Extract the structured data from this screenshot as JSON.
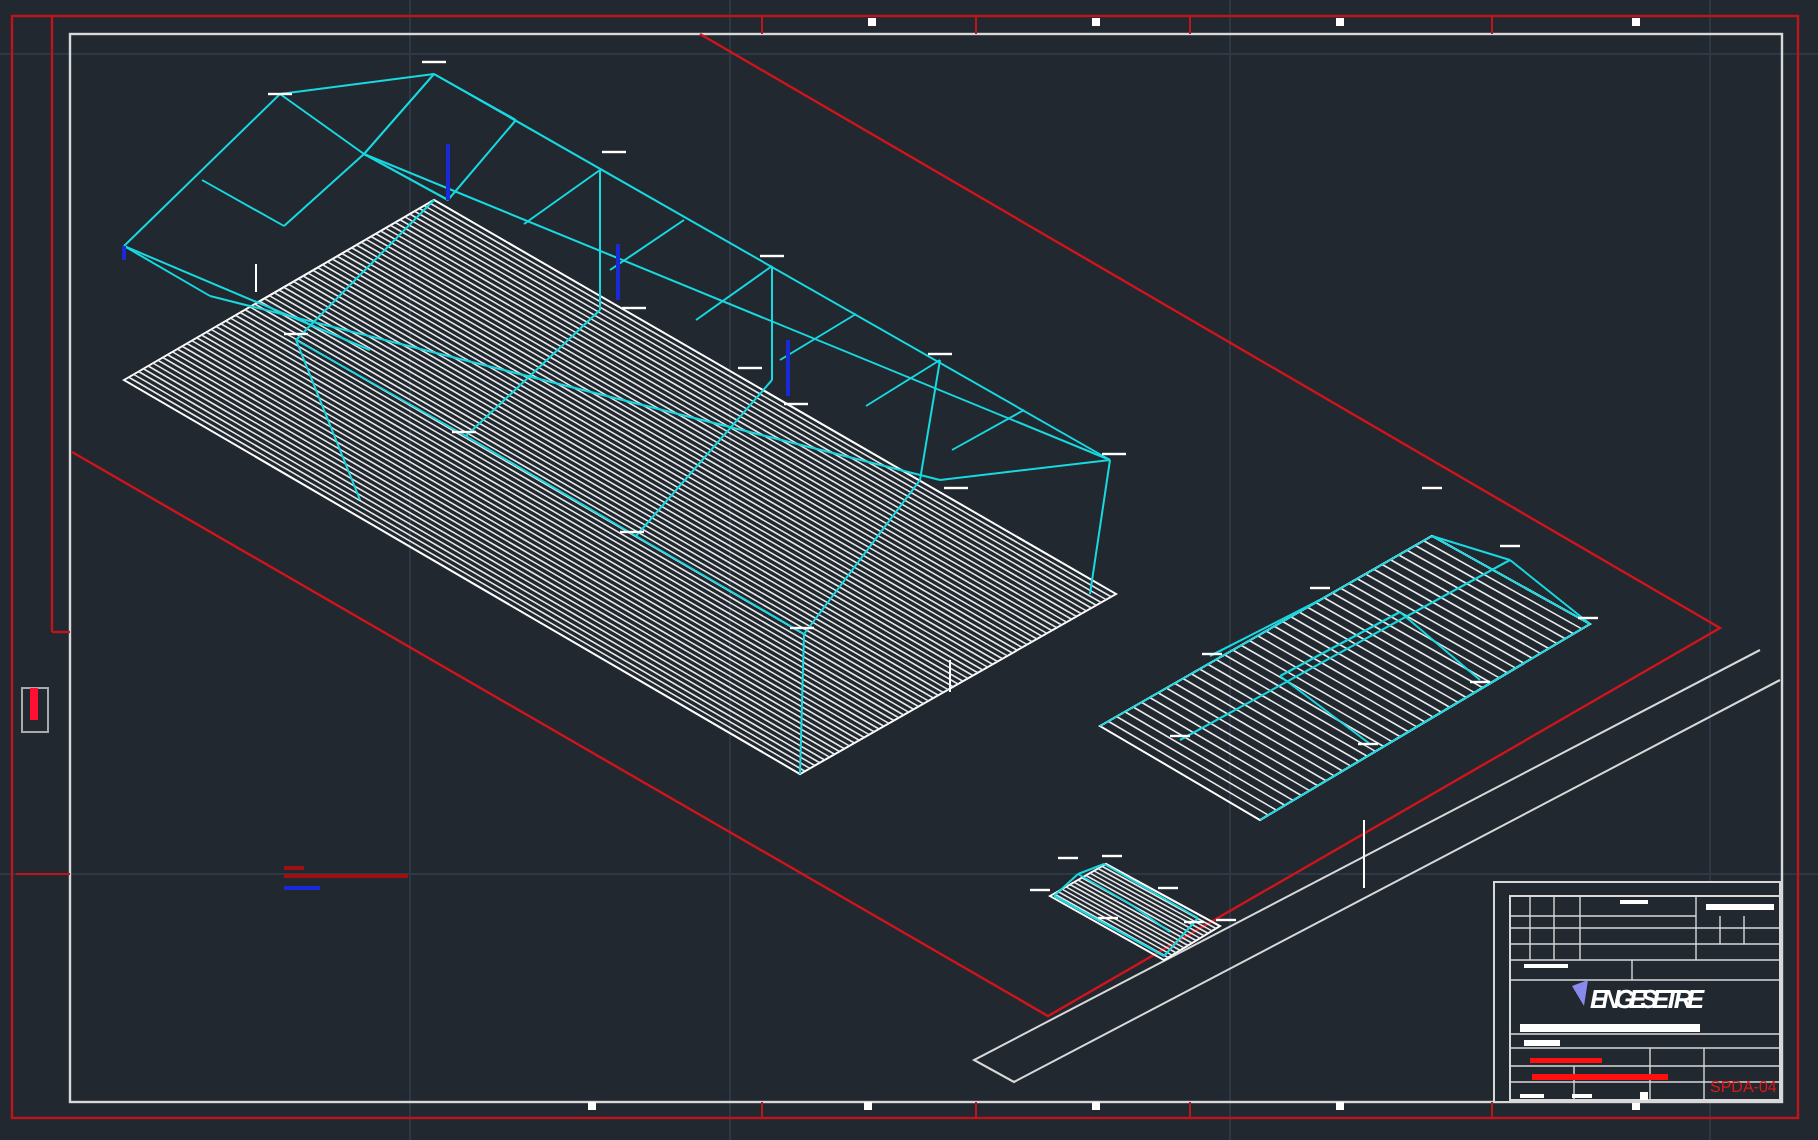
{
  "title_block": {
    "logo": "ENGESETRE",
    "sheet_code": "SPDA-04"
  }
}
